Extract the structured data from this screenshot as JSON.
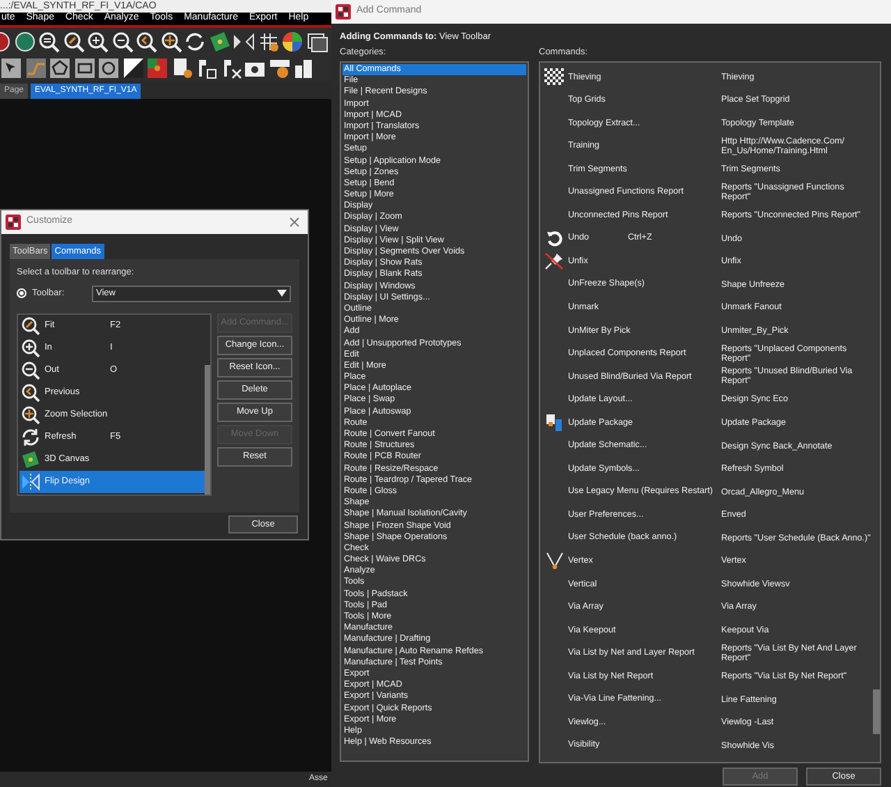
{
  "app": {
    "title": "...:/EVAL_SYNTH_RF_FI_V1A/CAO",
    "menu": [
      "ute",
      "Shape",
      "Check",
      "Analyze",
      "Tools",
      "Manufacture",
      "Export",
      "Help"
    ],
    "document_tabs": [
      {
        "label": "Page",
        "selected": false
      },
      {
        "label": "EVAL_SYNTH_RF_FI_V1A",
        "selected": true
      }
    ],
    "status_bar": "Asse"
  },
  "customize": {
    "title": "Customize",
    "tabs": [
      {
        "label": "ToolBars",
        "selected": false
      },
      {
        "label": "Commands",
        "selected": true
      }
    ],
    "prompt": "Select a toolbar to rearrange:",
    "toolbar_radio": {
      "label": "Toolbar:",
      "selected": true
    },
    "toolbar_select": {
      "value": "View"
    },
    "commands": [
      {
        "name": "Fit",
        "shortcut": "F2",
        "selected": false
      },
      {
        "name": "In",
        "shortcut": "I",
        "selected": false
      },
      {
        "name": "Out",
        "shortcut": "O",
        "selected": false
      },
      {
        "name": "Previous",
        "selected": false
      },
      {
        "name": "Zoom Selection",
        "selected": false
      },
      {
        "name": "Refresh",
        "shortcut": "F5",
        "selected": false
      },
      {
        "name": "3D Canvas",
        "selected": false
      },
      {
        "name": "Flip Design",
        "selected": true
      }
    ],
    "buttons": [
      {
        "label": "Add Command...",
        "disabled": true
      },
      {
        "label": "Change Icon...",
        "disabled": false
      },
      {
        "label": "Reset Icon...",
        "disabled": false
      },
      {
        "label": "Delete",
        "disabled": false
      },
      {
        "label": "Move Up",
        "disabled": false
      },
      {
        "label": "Move Down",
        "disabled": true
      },
      {
        "label": "Reset",
        "disabled": false
      }
    ],
    "close": "Close"
  },
  "add_command": {
    "title": "Add Command",
    "heading": "**Adding Commands to:** View Toolbar",
    "categories_label": "Categories:",
    "categories": [
      {
        "label": "All Commands",
        "selected": true
      },
      {
        "label": "File",
        "selected": false
      },
      {
        "label": "File | Recent Designs",
        "selected": false
      },
      {
        "label": "Import",
        "selected": false
      },
      {
        "label": "Import | MCAD",
        "selected": false
      },
      {
        "label": "Import | Translators",
        "selected": false
      },
      {
        "label": "Import | More",
        "selected": false
      },
      {
        "label": "Setup",
        "selected": false
      },
      {
        "label": "Setup | Application Mode",
        "selected": false
      },
      {
        "label": "Setup | Zones",
        "selected": false
      },
      {
        "label": "Setup | Bend",
        "selected": false
      },
      {
        "label": "Setup | More",
        "selected": false
      },
      {
        "label": "Display",
        "selected": false
      },
      {
        "label": "Display | Zoom",
        "selected": false
      },
      {
        "label": "Display | View",
        "selected": false
      },
      {
        "label": "Display | View | Split View",
        "selected": false
      },
      {
        "label": "Display | Segments Over Voids",
        "selected": false
      },
      {
        "label": "Display | Show Rats",
        "selected": false
      },
      {
        "label": "Display | Blank Rats",
        "selected": false
      },
      {
        "label": "Display | Windows",
        "selected": false
      },
      {
        "label": "Display | UI Settings...",
        "selected": false
      },
      {
        "label": "Outline",
        "selected": false
      },
      {
        "label": "Outline | More",
        "selected": false
      },
      {
        "label": "Add",
        "selected": false
      },
      {
        "label": "Add | Unsupported Prototypes",
        "selected": false
      },
      {
        "label": "Edit",
        "selected": false
      },
      {
        "label": "Edit | More",
        "selected": false
      },
      {
        "label": "Place",
        "selected": false
      },
      {
        "label": "Place | Autoplace",
        "selected": false
      },
      {
        "label": "Place | Swap",
        "selected": false
      },
      {
        "label": "Place | Autoswap",
        "selected": false
      },
      {
        "label": "Route",
        "selected": false
      },
      {
        "label": "Route | Convert Fanout",
        "selected": false
      },
      {
        "label": "Route | Structures",
        "selected": false
      },
      {
        "label": "Route | PCB Router",
        "selected": false
      },
      {
        "label": "Route | Resize/Respace",
        "selected": false
      },
      {
        "label": "Route | Teardrop / Tapered Trace",
        "selected": false
      },
      {
        "label": "Route | Gloss",
        "selected": false
      },
      {
        "label": "Shape",
        "selected": false
      },
      {
        "label": "Shape | Manual Isolation/Cavity",
        "selected": false
      },
      {
        "label": "Shape | Frozen Shape Void",
        "selected": false
      },
      {
        "label": "Shape | Shape Operations",
        "selected": false
      },
      {
        "label": "Check",
        "selected": false
      },
      {
        "label": "Check | Waive DRCs",
        "selected": false
      },
      {
        "label": "Analyze",
        "selected": false
      },
      {
        "label": "Tools",
        "selected": false
      },
      {
        "label": "Tools | Padstack",
        "selected": false
      },
      {
        "label": "Tools | Pad",
        "selected": false
      },
      {
        "label": "Tools | More",
        "selected": false
      },
      {
        "label": "Manufacture",
        "selected": false
      },
      {
        "label": "Manufacture | Drafting",
        "selected": false
      },
      {
        "label": "Manufacture | Auto Rename Refdes",
        "selected": false
      },
      {
        "label": "Manufacture | Test Points",
        "selected": false
      },
      {
        "label": "Export",
        "selected": false
      },
      {
        "label": "Export | MCAD",
        "selected": false
      },
      {
        "label": "Export | Variants",
        "selected": false
      },
      {
        "label": "Export | Quick Reports",
        "selected": false
      },
      {
        "label": "Export | More",
        "selected": false
      },
      {
        "label": "Help",
        "selected": false
      },
      {
        "label": "Help | Web Resources",
        "selected": false
      }
    ],
    "commands_label": "Commands:",
    "commands": [
      {
        "name": "Thieving",
        "command": "Thieving"
      },
      {
        "name": "Top Grids",
        "command": "Place Set Topgrid"
      },
      {
        "name": "Topology Extract...",
        "command": "Topology Template"
      },
      {
        "name": "Training",
        "command": "Http Http://Www.Cadence.Com/ En_Us/Home/Training.Html"
      },
      {
        "name": "Trim Segments",
        "command": "Trim Segments"
      },
      {
        "name": "Unassigned Functions Report",
        "command": "Reports \"Unassigned Functions Report\""
      },
      {
        "name": "Unconnected Pins Report",
        "command": "Reports \"Unconnected Pins Report\""
      },
      {
        "name": "Undo",
        "shortcut": "Ctrl+Z",
        "command": "Undo"
      },
      {
        "name": "Unfix",
        "command": "Unfix"
      },
      {
        "name": "UnFreeze Shape(s)",
        "command": "Shape Unfreeze"
      },
      {
        "name": "Unmark",
        "command": "Unmark Fanout"
      },
      {
        "name": "UnMiter By Pick",
        "command": "Unmiter_By_Pick"
      },
      {
        "name": "Unplaced Components Report",
        "command": "Reports \"Unplaced Components Report\""
      },
      {
        "name": "Unused Blind/Buried Via Report",
        "command": "Reports \"Unused Blind/Buried Via Report\""
      },
      {
        "name": "Update Layout...",
        "command": "Design Sync Eco"
      },
      {
        "name": "Update Package",
        "command": "Update Package"
      },
      {
        "name": "Update Schematic...",
        "command": "Design Sync Back_Annotate"
      },
      {
        "name": "Update Symbols...",
        "command": "Refresh Symbol"
      },
      {
        "name": "Use Legacy Menu (Requires Restart)",
        "command": "Orcad_Allegro_Menu"
      },
      {
        "name": "User Preferences...",
        "command": "Enved"
      },
      {
        "name": "User Schedule (back anno.)",
        "command": "Reports \"User Schedule (Back Anno.)\""
      },
      {
        "name": "Vertex",
        "command": "Vertex"
      },
      {
        "name": "Vertical",
        "command": "Showhide Viewsv"
      },
      {
        "name": "Via Array",
        "command": "Via Array"
      },
      {
        "name": "Via Keepout",
        "command": "Keepout Via"
      },
      {
        "name": "Via List by Net and Layer Report",
        "command": "Reports \"Via List By Net And Layer Report\""
      },
      {
        "name": "Via List by Net Report",
        "command": "Reports \"Via List By Net Report\""
      },
      {
        "name": "Via-Via Line Fattening...",
        "command": "Line Fattening"
      },
      {
        "name": "Viewlog...",
        "command": "Viewlog -Last"
      },
      {
        "name": "Visibility",
        "command": "Showhide Vis"
      }
    ],
    "buttons": [
      {
        "label": "Add",
        "disabled": true
      },
      {
        "label": "Close",
        "disabled": false
      }
    ]
  }
}
